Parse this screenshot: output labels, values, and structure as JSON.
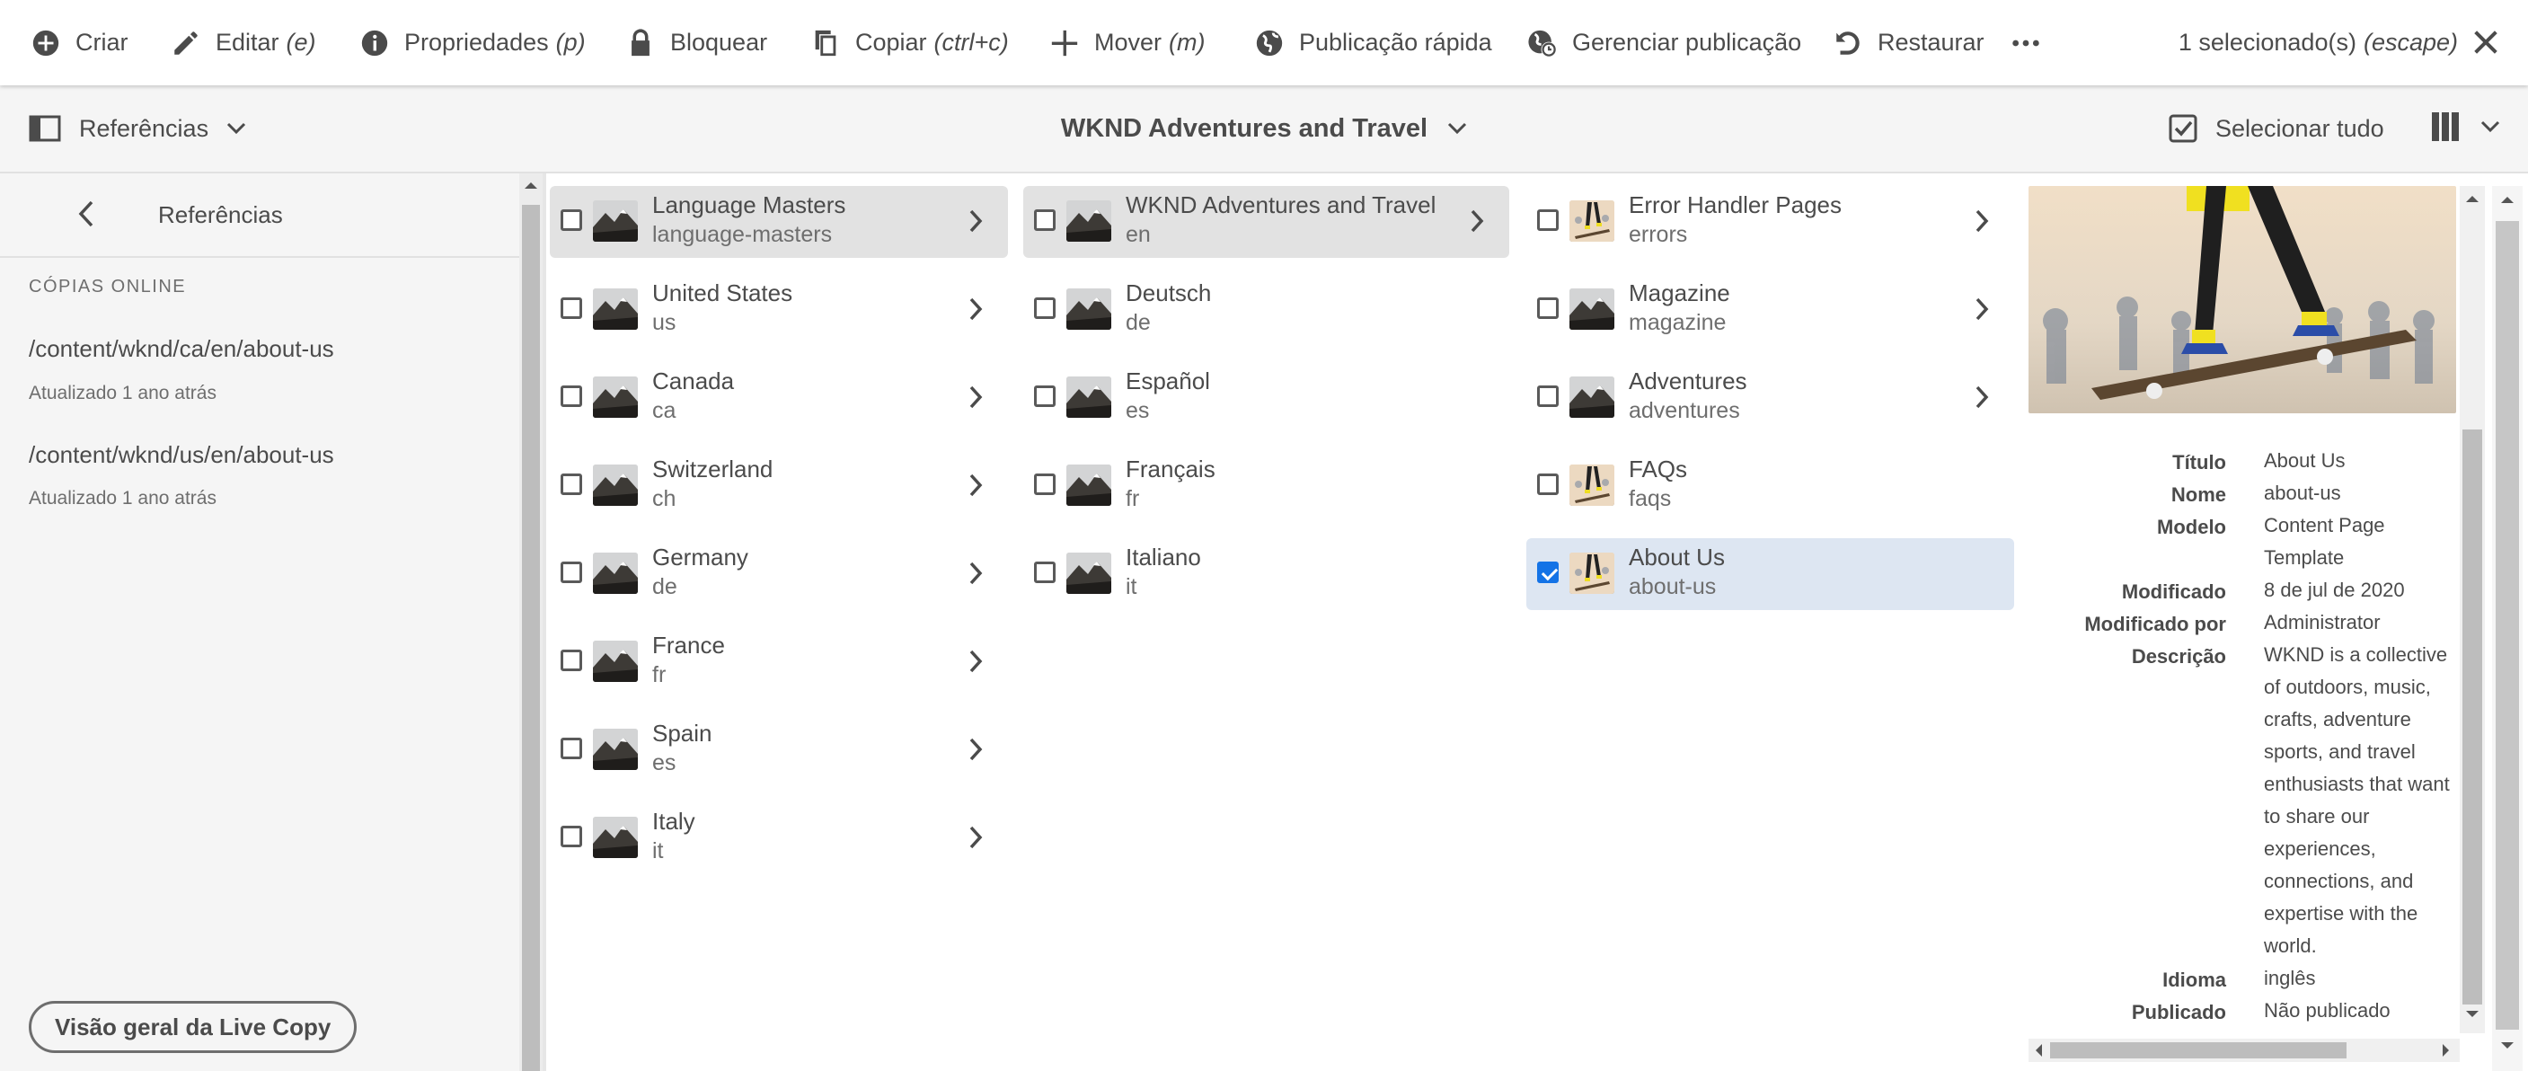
{
  "actionbar": {
    "actions": [
      {
        "label": "Criar",
        "shortcut": "",
        "icon": "add-circle-icon"
      },
      {
        "label": "Editar",
        "shortcut": "(e)",
        "icon": "pencil-icon"
      },
      {
        "label": "Propriedades",
        "shortcut": "(p)",
        "icon": "info-icon"
      },
      {
        "label": "Bloquear",
        "shortcut": "",
        "icon": "lock-icon"
      },
      {
        "label": "Copiar",
        "shortcut": "(ctrl+c)",
        "icon": "copy-icon"
      },
      {
        "label": "Mover",
        "shortcut": "(m)",
        "icon": "move-icon"
      },
      {
        "label": "Publicação rápida",
        "shortcut": "",
        "icon": "globe-icon"
      },
      {
        "label": "Gerenciar publicação",
        "shortcut": "",
        "icon": "globe-clock-icon"
      },
      {
        "label": "Restaurar",
        "shortcut": "",
        "icon": "undo-icon"
      }
    ],
    "more_icon": "more-icon",
    "selection_text": "1 selecionado(s)",
    "selection_shortcut": "(escape)",
    "close_icon": "close-icon"
  },
  "titlebar": {
    "rail_label": "Referências",
    "title": "WKND Adventures and Travel",
    "select_all": "Selecionar tudo"
  },
  "rail": {
    "title": "Referências",
    "section": "CÓPIAS ONLINE",
    "items": [
      {
        "path": "/content/wknd/ca/en/about-us",
        "meta": "Atualizado 1 ano atrás"
      },
      {
        "path": "/content/wknd/us/en/about-us",
        "meta": "Atualizado 1 ano atrás"
      }
    ],
    "button": "Visão geral da Live Copy"
  },
  "columns": [
    {
      "rows": [
        {
          "title": "Language Masters",
          "name": "language-masters",
          "thumb": "mountain",
          "children": true,
          "state": "active"
        },
        {
          "title": "United States",
          "name": "us",
          "thumb": "mountain",
          "children": true,
          "state": ""
        },
        {
          "title": "Canada",
          "name": "ca",
          "thumb": "mountain",
          "children": true,
          "state": ""
        },
        {
          "title": "Switzerland",
          "name": "ch",
          "thumb": "mountain",
          "children": true,
          "state": ""
        },
        {
          "title": "Germany",
          "name": "de",
          "thumb": "mountain",
          "children": true,
          "state": ""
        },
        {
          "title": "France",
          "name": "fr",
          "thumb": "mountain",
          "children": true,
          "state": ""
        },
        {
          "title": "Spain",
          "name": "es",
          "thumb": "mountain",
          "children": true,
          "state": ""
        },
        {
          "title": "Italy",
          "name": "it",
          "thumb": "mountain",
          "children": true,
          "state": ""
        }
      ]
    },
    {
      "rows": [
        {
          "title": "WKND Adventures and Travel",
          "name": "en",
          "thumb": "mountain",
          "children": true,
          "state": "active"
        },
        {
          "title": "Deutsch",
          "name": "de",
          "thumb": "mountain",
          "children": false,
          "state": ""
        },
        {
          "title": "Español",
          "name": "es",
          "thumb": "mountain",
          "children": false,
          "state": ""
        },
        {
          "title": "Français",
          "name": "fr",
          "thumb": "mountain",
          "children": false,
          "state": ""
        },
        {
          "title": "Italiano",
          "name": "it",
          "thumb": "mountain",
          "children": false,
          "state": ""
        }
      ]
    },
    {
      "rows": [
        {
          "title": "Error Handler Pages",
          "name": "errors",
          "thumb": "skate",
          "children": true,
          "state": ""
        },
        {
          "title": "Magazine",
          "name": "magazine",
          "thumb": "mountain",
          "children": true,
          "state": ""
        },
        {
          "title": "Adventures",
          "name": "adventures",
          "thumb": "mountain",
          "children": true,
          "state": ""
        },
        {
          "title": "FAQs",
          "name": "faqs",
          "thumb": "skate",
          "children": false,
          "state": ""
        },
        {
          "title": "About Us",
          "name": "about-us",
          "thumb": "skate",
          "children": false,
          "state": "selected"
        }
      ]
    }
  ],
  "meta": {
    "labels": {
      "title": "Título",
      "name": "Nome",
      "template": "Modelo",
      "modified": "Modificado",
      "modified_by": "Modificado por",
      "description": "Descrição",
      "language": "Idioma",
      "published": "Publicado"
    },
    "values": {
      "title": "About Us",
      "name": "about-us",
      "template": "Content Page Template",
      "modified": "8 de jul de 2020",
      "modified_by": "Administrator",
      "description": "WKND is a collective of outdoors, music, crafts, adventure sports, and travel enthusiasts that want to share our experiences, connections, and expertise with the world.",
      "language": "inglês",
      "published": "Não publicado"
    }
  },
  "colors": {
    "accent": "#1473e6",
    "selected_row": "#dde6f2",
    "active_row": "#e2e2e2"
  }
}
